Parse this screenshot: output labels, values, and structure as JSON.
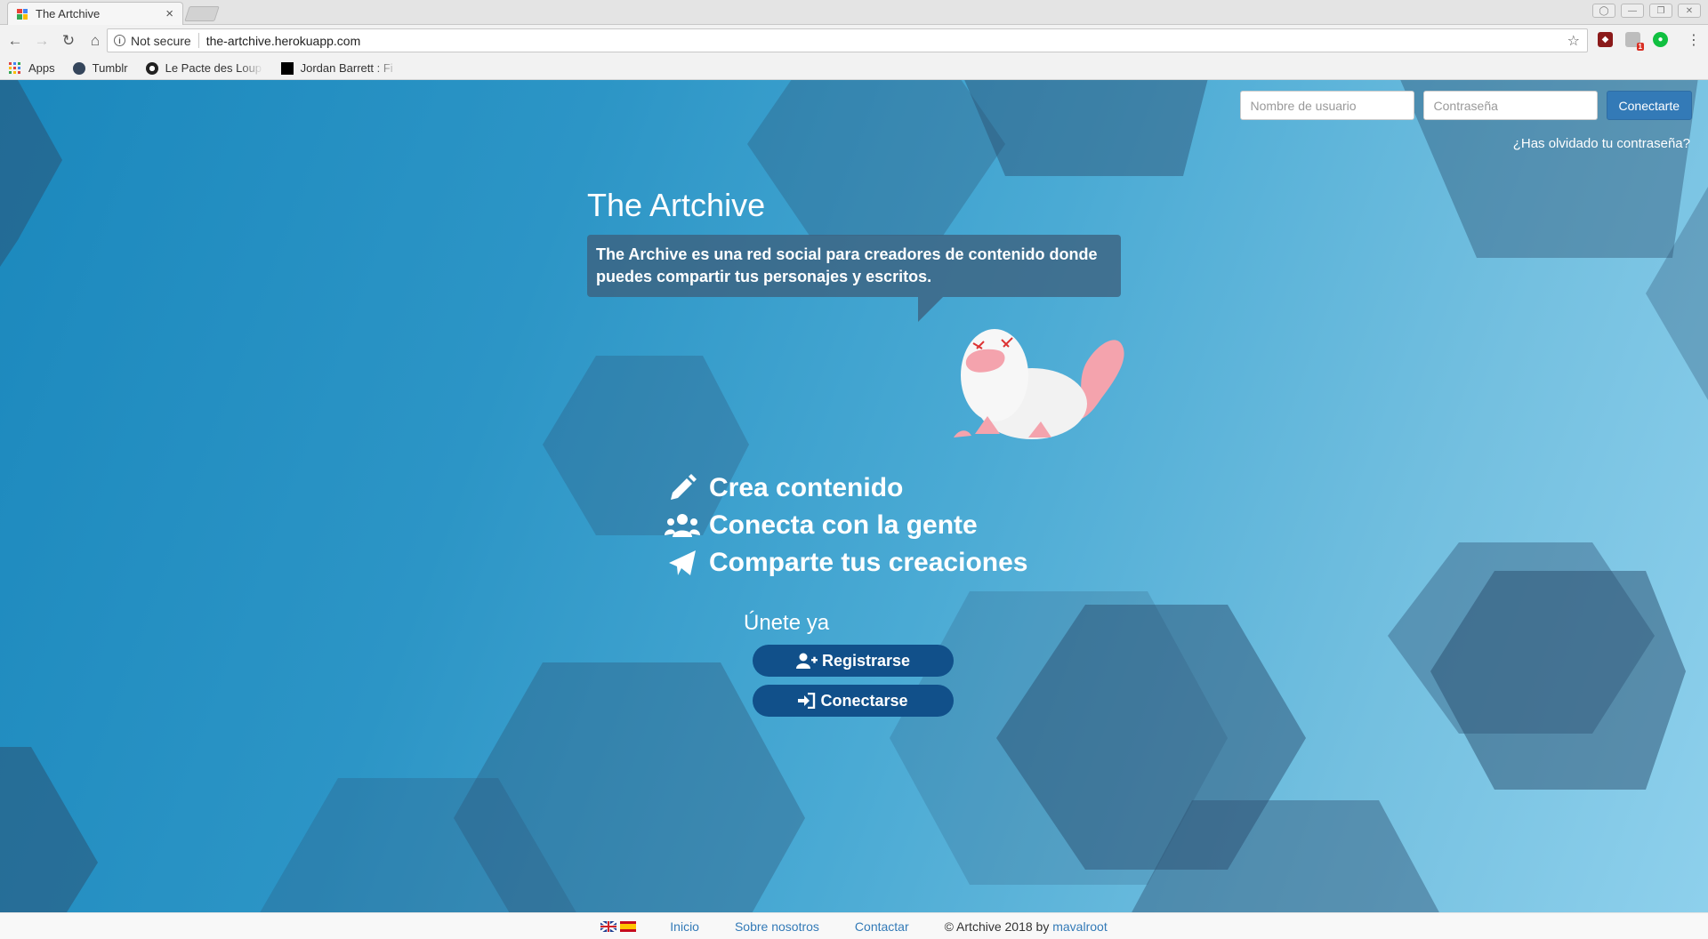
{
  "browser": {
    "tab_title": "The Artchive",
    "tab_close": "×",
    "security_label": "Not secure",
    "url": "the-artchive.herokuapp.com",
    "bookmarks": [
      {
        "label": "Apps"
      },
      {
        "label": "Tumblr"
      },
      {
        "label": "Le Pacte des Loup"
      },
      {
        "label": "Jordan Barrett : Fi"
      }
    ],
    "extension_badge": "1"
  },
  "login": {
    "username_placeholder": "Nombre de usuario",
    "password_placeholder": "Contraseña",
    "submit_label": "Conectarte",
    "forgot_label": "¿Has olvidado tu contraseña?"
  },
  "hero": {
    "title": "The Artchive",
    "description": "The Archive es una red social para creadores de contenido donde puedes compartir tus personajes y escritos."
  },
  "features": [
    {
      "icon": "pencil-icon",
      "label": "Crea contenido"
    },
    {
      "icon": "users-icon",
      "label": "Conecta con la gente"
    },
    {
      "icon": "paper-plane-icon",
      "label": "Comparte tus creaciones"
    }
  ],
  "join": {
    "heading": "Únete ya",
    "register_label": "Registrarse",
    "login_label": "Conectarse"
  },
  "footer": {
    "links": [
      "Inicio",
      "Sobre nosotros",
      "Contactar"
    ],
    "copyright": "© Artchive 2018 by",
    "author": "mavalroot"
  },
  "colors": {
    "primary_button": "#337ab7",
    "cta_button": "#11508a",
    "bubble": "#3c607d",
    "link": "#337ab7"
  }
}
